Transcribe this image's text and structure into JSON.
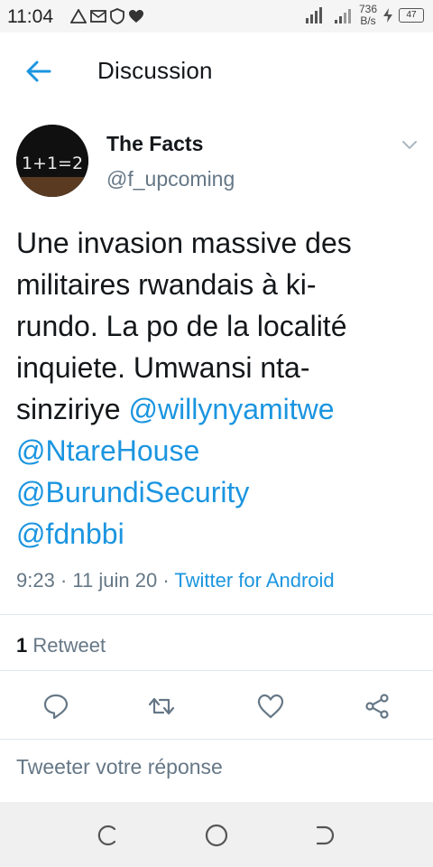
{
  "status_bar": {
    "time": "11:04",
    "left_icons": [
      "warning-icon",
      "mail-icon",
      "shield-icon",
      "heart-icon"
    ],
    "network_speed_value": "736",
    "network_speed_unit": "B/s",
    "battery": "47"
  },
  "header": {
    "title": "Discussion"
  },
  "tweet": {
    "author_name": "The Facts",
    "author_handle": "@f_upcoming",
    "avatar_text": "1+1=2",
    "text_lines": [
      "Une invasion massive des",
      "militaires rwandais à ki-",
      "rundo. La po de la localité",
      "inquiete. Umwansi nta-"
    ],
    "text_last_prefix": "sinziriye ",
    "mentions": [
      "@willynyamitwe",
      "@NtareHouse",
      "@BurundiSecurity",
      "@fdnbbi"
    ],
    "time": "9:23",
    "date": "11 juin 20",
    "source": "Twitter for Android",
    "retweet_count": "1",
    "retweet_label": "Retweet"
  },
  "reply": {
    "placeholder": "Tweeter votre réponse"
  },
  "colors": {
    "accent": "#1b95e0",
    "text_primary": "#14171a",
    "text_secondary": "#657786",
    "divider": "#e1e8ed"
  }
}
